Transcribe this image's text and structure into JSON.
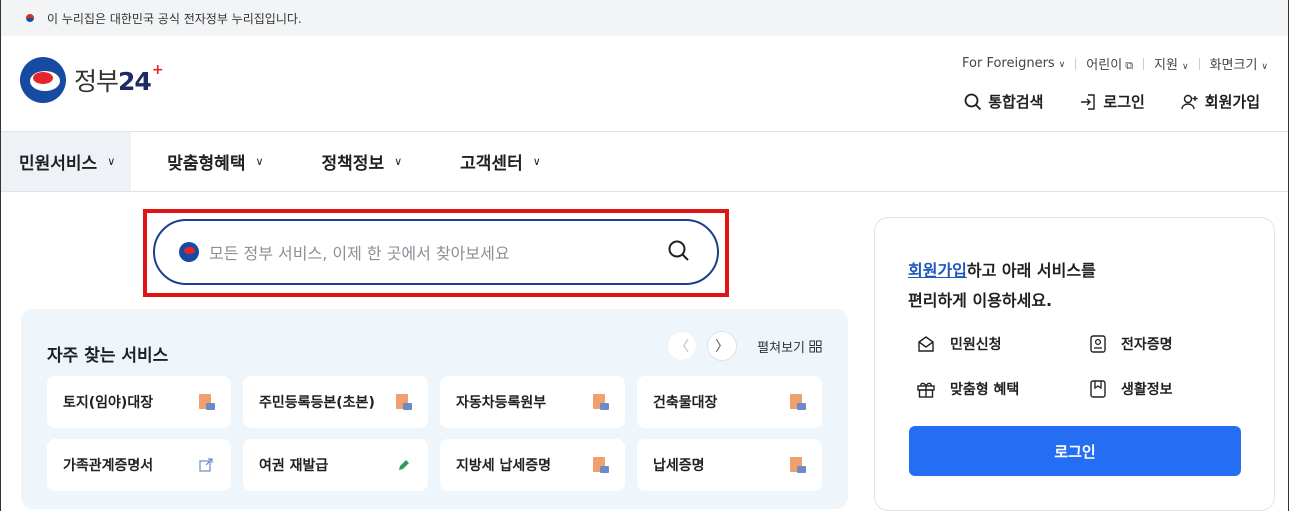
{
  "banner": {
    "text": "이 누리집은 대한민국 공식 전자정부 누리집입니다."
  },
  "logo": {
    "text": "정부",
    "num": "24"
  },
  "util": {
    "foreigners": "For Foreigners",
    "kids": "어린이",
    "support": "지원",
    "screen_size": "화면크기"
  },
  "actions": {
    "search": "통합검색",
    "login": "로그인",
    "signup": "회원가입"
  },
  "nav": [
    "민원서비스",
    "맞춤형혜택",
    "정책정보",
    "고객센터"
  ],
  "search": {
    "placeholder": "모든 정부 서비스, 이제 한 곳에서 찾아보세요"
  },
  "frequent": {
    "title": "자주 찾는 서비스",
    "expand": "펼쳐보기",
    "items": [
      {
        "label": "토지(임야)대장",
        "icon": "document-icon"
      },
      {
        "label": "주민등록등본(초본)",
        "icon": "document-icon"
      },
      {
        "label": "자동차등록원부",
        "icon": "document-icon"
      },
      {
        "label": "건축물대장",
        "icon": "document-icon"
      },
      {
        "label": "가족관계증명서",
        "icon": "external-link-icon"
      },
      {
        "label": "여권 재발급",
        "icon": "pencil-icon"
      },
      {
        "label": "지방세 납세증명",
        "icon": "document-icon"
      },
      {
        "label": "납세증명",
        "icon": "document-icon"
      }
    ]
  },
  "side": {
    "signup_link": "회원가입",
    "line1_rest": "하고 아래 서비스를",
    "line2": "편리하게 이용하세요.",
    "services": [
      "민원신청",
      "전자증명",
      "맞춤형 혜택",
      "생활정보"
    ],
    "login_button": "로그인"
  }
}
